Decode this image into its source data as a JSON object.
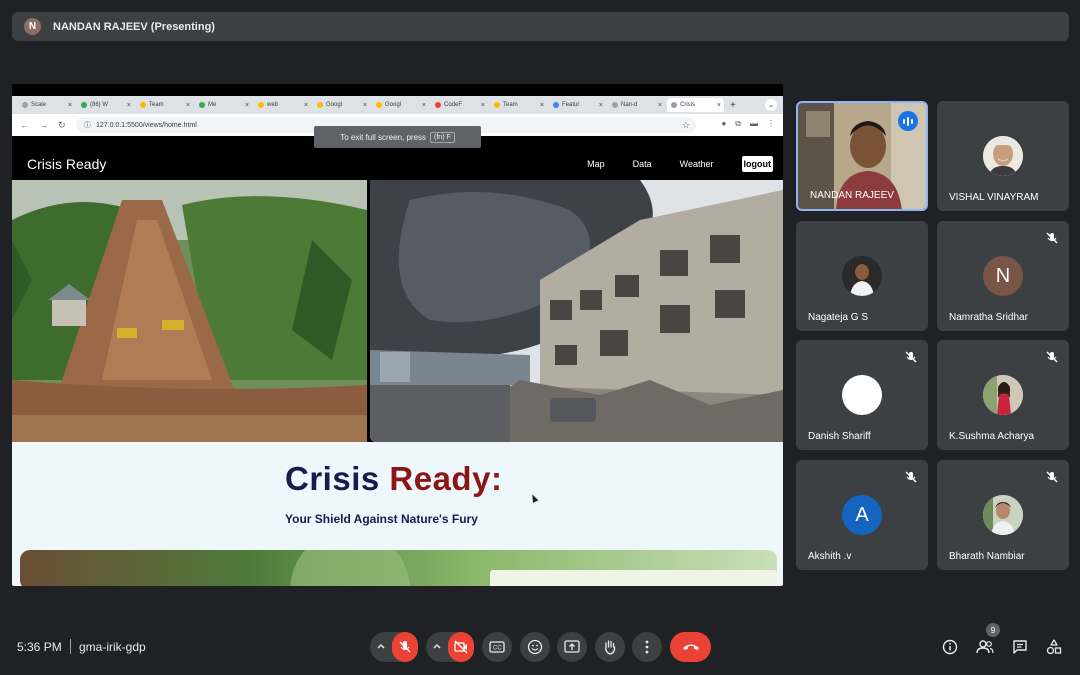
{
  "presenter": {
    "initial": "N",
    "label": "NANDAN RAJEEV (Presenting)"
  },
  "browser": {
    "tabs": [
      "Scale",
      "(86) W",
      "Team",
      "Me",
      "web",
      "Googl",
      "Googl",
      "CodeF",
      "Team",
      "Featur",
      "Nan-d",
      "Crisis"
    ],
    "url": "127.0.0.1:5500/views/home.html",
    "fullscreen_hint": "To exit full screen, press",
    "fullscreen_key": "(fn) F"
  },
  "site": {
    "brand": "Crisis Ready",
    "nav": {
      "map": "Map",
      "data": "Data",
      "weather": "Weather",
      "logout": "logout"
    },
    "title_part1": "Crisis",
    "title_part2": "Ready:",
    "tagline": "Your Shield Against Nature's Fury"
  },
  "participants": {
    "nandan": {
      "name": "NANDAN RAJEEV"
    },
    "vishal": {
      "name": "VISHAL VINAYRAM"
    },
    "nagateja": {
      "name": "Nagateja G S"
    },
    "namratha": {
      "name": "Namratha Sridhar",
      "initial": "N"
    },
    "danish": {
      "name": "Danish Shariff"
    },
    "sushma": {
      "name": "K.Sushma Acharya"
    },
    "akshith": {
      "name": "Akshith .v",
      "initial": "A"
    },
    "bharath": {
      "name": "Bharath Nambiar"
    }
  },
  "footer": {
    "time": "5:36 PM",
    "meeting_code": "gma-irik-gdp",
    "people_count": "9"
  },
  "colors": {
    "accent": "#1a73e8",
    "danger": "#ea4335",
    "title_dark": "#1a1a4e",
    "title_red": "#8b1616"
  }
}
